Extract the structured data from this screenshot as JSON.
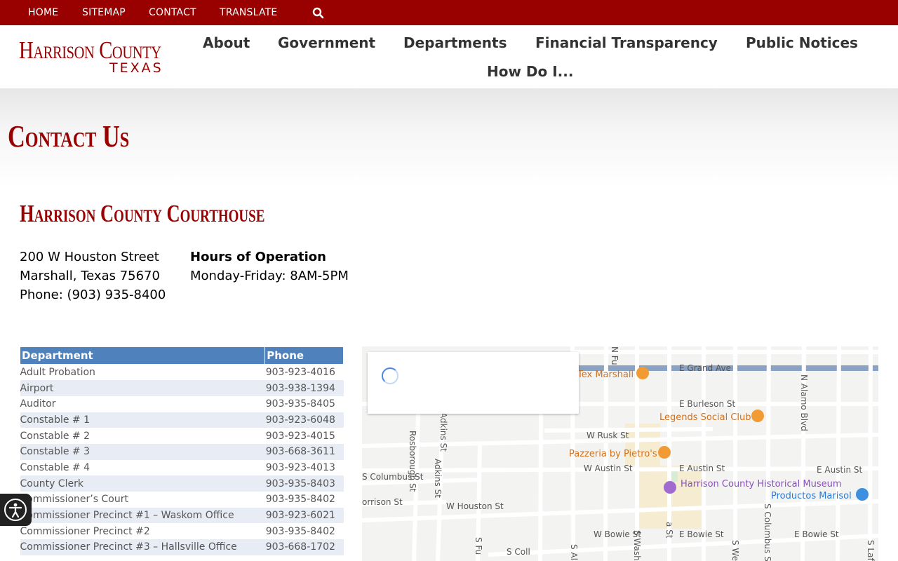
{
  "topbar": {
    "links": [
      "HOME",
      "SITEMAP",
      "CONTACT",
      "TRANSLATE"
    ],
    "search_icon": "search-icon"
  },
  "logo": {
    "line1": "Harrison County",
    "line2": "TEXAS"
  },
  "nav": {
    "items": [
      "About",
      "Government",
      "Departments",
      "Financial Transparency",
      "Public Notices",
      "How Do I..."
    ]
  },
  "page": {
    "title": "Contact Us",
    "section_title": "Harrison County Courthouse",
    "address": {
      "street": "200 W Houston Street",
      "city": "Marshall, Texas 75670",
      "phone": "Phone: (903) 935-8400"
    },
    "hours": {
      "heading": "Hours of Operation",
      "value": "Monday-Friday: 8AM-5PM"
    }
  },
  "table": {
    "headers": [
      "Department",
      "Phone"
    ],
    "rows": [
      {
        "dept": "Adult Probation",
        "phone": "903-923-4016"
      },
      {
        "dept": "Airport",
        "phone": "903-938-1394"
      },
      {
        "dept": "Auditor",
        "phone": "903-935-8405"
      },
      {
        "dept": "Constable # 1",
        "phone": "903-923-6048"
      },
      {
        "dept": "Constable # 2",
        "phone": "903-923-4015"
      },
      {
        "dept": "Constable # 3",
        "phone": "903-668-3611"
      },
      {
        "dept": "Constable # 4",
        "phone": "903-923-4013"
      },
      {
        "dept": "County Clerk",
        "phone": "903-935-8403"
      },
      {
        "dept": "Commissioner’s Court",
        "phone": "903-935-8402"
      },
      {
        "dept": "Commissioner Precinct #1 – Waskom Office",
        "phone": "903-923-6021"
      },
      {
        "dept": "Commissioner Precinct #2",
        "phone": "903-935-8402"
      },
      {
        "dept": "Commissioner Precinct #3 – Hallsville Office",
        "phone": "903-668-1702"
      }
    ]
  },
  "map": {
    "streets": [
      "E Grand Ave",
      "E Burleson St",
      "W Rusk St",
      "W Austin St",
      "E Austin St",
      "E Austin St",
      "W Houston St",
      "W Bowie St",
      "E Bowie St",
      "E Bowie St",
      "Rosborough St",
      "Adkins St",
      "Adkins St",
      "N Alamo Blvd",
      "S Columbus St",
      "orrison St",
      "a St",
      "S Washing",
      "S Wellin",
      "S Laf",
      "S Ala",
      "S Fu",
      "S Coll",
      "W Bowie St",
      "N Fu"
    ],
    "places": [
      "Tex Marshall",
      "Legends Social Club",
      "Pazzeria by Pietro's",
      "Harrison County Historical Museum",
      "Productos Marisol"
    ],
    "road_color": "#ffffff",
    "highway_color": "#8aa3c5",
    "poi_orange": "#f29a34",
    "poi_purple": "#a06ad0",
    "poi_blue": "#3f8fe0",
    "spinner_color": "#4a86e8"
  },
  "a11y": {
    "icon": "accessibility-icon"
  },
  "colors": {
    "brand_red": "#990000",
    "table_header": "#4f81bd",
    "table_alt_row": "#e8ecf5"
  }
}
